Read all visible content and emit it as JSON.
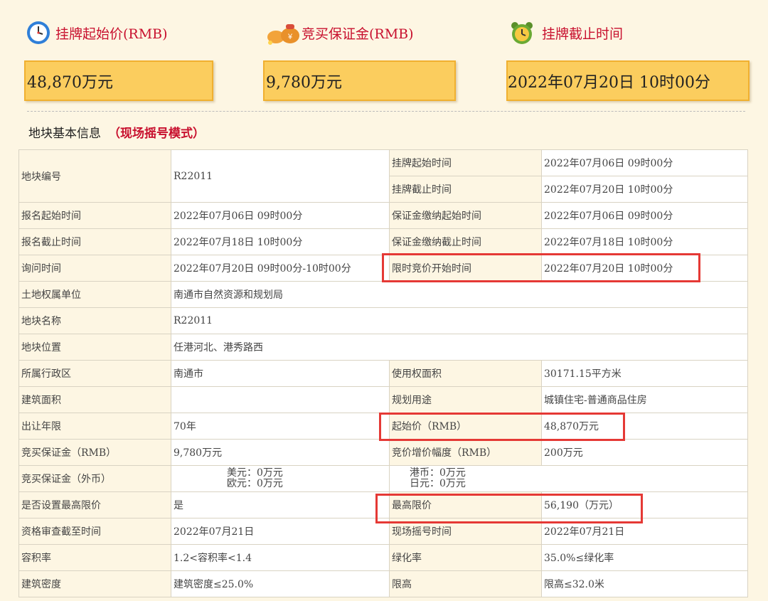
{
  "header": {
    "items": [
      {
        "label": "挂牌起始价(RMB)",
        "value": "48,870万元",
        "icon": "clock-icon"
      },
      {
        "label": "竞买保证金(RMB)",
        "value": "9,780万元",
        "icon": "money-bag-icon"
      },
      {
        "label": "挂牌截止时间",
        "value": "2022年07月20日 10时00分",
        "icon": "alarm-clock-icon"
      }
    ]
  },
  "section": {
    "title": "地块基本信息",
    "mode": "（现场摇号模式）"
  },
  "table": {
    "r0": {
      "l1": "地块编号",
      "v1": "R22011",
      "l2a": "挂牌起始时间",
      "v2a": "2022年07月06日 09时00分",
      "l2b": "挂牌截止时间",
      "v2b": "2022年07月20日 10时00分"
    },
    "r1": {
      "l1": "报名起始时间",
      "v1": "2022年07月06日 09时00分",
      "l2": "保证金缴纳起始时间",
      "v2": "2022年07月06日 09时00分"
    },
    "r2": {
      "l1": "报名截止时间",
      "v1": "2022年07月18日 10时00分",
      "l2": "保证金缴纳截止时间",
      "v2": "2022年07月18日 10时00分"
    },
    "r3": {
      "l1": "询问时间",
      "v1": "2022年07月20日 09时00分-10时00分",
      "l2": "限时竞价开始时间",
      "v2": "2022年07月20日 10时00分"
    },
    "r4": {
      "l1": "土地权属单位",
      "v1": "南通市自然资源和规划局"
    },
    "r5": {
      "l1": "地块名称",
      "v1": "R22011"
    },
    "r6": {
      "l1": "地块位置",
      "v1": "任港河北、港秀路西"
    },
    "r7": {
      "l1": "所属行政区",
      "v1": "南通市",
      "l2": "使用权面积",
      "v2": "30171.15平方米"
    },
    "r8": {
      "l1": "建筑面积",
      "v1": "",
      "l2": "规划用途",
      "v2": "城镇住宅-普通商品住房"
    },
    "r9": {
      "l1": "出让年限",
      "v1": "70年",
      "l2": "起始价（RMB）",
      "v2": "48,870万元"
    },
    "r10": {
      "l1": "竞买保证金（RMB）",
      "v1": "9,780万元",
      "l2": "竞价增价幅度（RMB）",
      "v2": "200万元"
    },
    "r11": {
      "l1": "竞买保证金（外币）",
      "usd": "美元：0万元",
      "eur": "欧元：0万元",
      "hkd": "港币：0万元",
      "jpy": "日元：0万元"
    },
    "r12": {
      "l1": "是否设置最高限价",
      "v1": "是",
      "l2": "最高限价",
      "v2": "56,190（万元）"
    },
    "r13": {
      "l1": "资格审查截至时间",
      "v1": "2022年07月21日",
      "l2": "现场摇号时间",
      "v2": "2022年07月21日"
    },
    "r14": {
      "l1": "容积率",
      "v1": "1.2<容积率<1.4",
      "l2": "绿化率",
      "v2": "35.0%≤绿化率"
    },
    "r15": {
      "l1": "建筑密度",
      "v1": "建筑密度≤25.0%",
      "l2": "限高",
      "v2": "限高≤32.0米"
    }
  }
}
